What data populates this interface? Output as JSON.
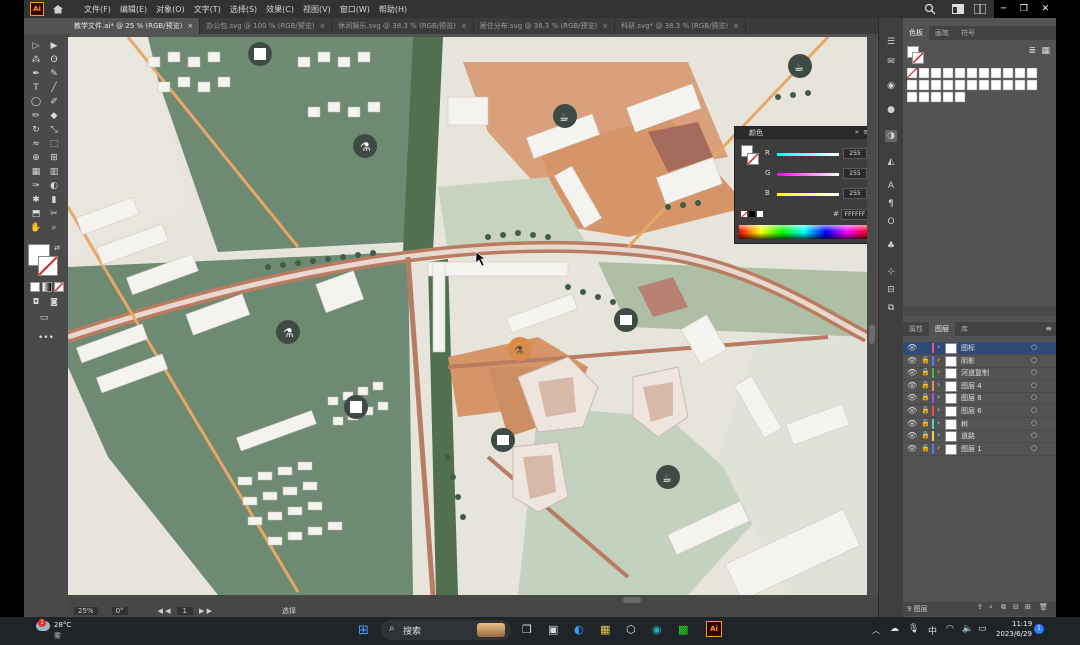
{
  "app": {
    "logo": "Ai"
  },
  "menu": [
    "文件(F)",
    "编辑(E)",
    "对象(O)",
    "文字(T)",
    "选择(S)",
    "效果(C)",
    "视图(V)",
    "窗口(W)",
    "帮助(H)"
  ],
  "tabs": [
    {
      "label": "教学文件.ai* @ 25 % (RGB/预览)",
      "active": true
    },
    {
      "label": "办公包.svg @ 100 % (RGB/预览)",
      "active": false
    },
    {
      "label": "休闲娱乐.svg @ 38.3 % (RGB/预览)",
      "active": false
    },
    {
      "label": "居住分布.svg @ 38.3 % (RGB/预览)",
      "active": false
    },
    {
      "label": "科研.svg* @ 38.3 % (RGB/预览)",
      "active": false
    }
  ],
  "swatch_panel": {
    "tabs": [
      "色板",
      "画笔",
      "符号"
    ]
  },
  "color_panel": {
    "title": "颜色",
    "r": "255",
    "g": "255",
    "b": "255",
    "hex": "FFFFFF",
    "labels": [
      "R",
      "G",
      "B"
    ]
  },
  "layers_panel": {
    "tabs": [
      "属性",
      "图层",
      "库"
    ],
    "layers": [
      {
        "name": "图标",
        "color": "#f04f7c",
        "selected": true
      },
      {
        "name": "阴影",
        "color": "#4f7cf0",
        "selected": false
      },
      {
        "name": "河道复制",
        "color": "#4fb04f",
        "selected": false
      },
      {
        "name": "图层 4",
        "color": "#f08c4f",
        "selected": false
      },
      {
        "name": "图层 8",
        "color": "#9c4ff0",
        "selected": false
      },
      {
        "name": "图层 6",
        "color": "#f04f4f",
        "selected": false
      },
      {
        "name": "树",
        "color": "#4fd0d0",
        "selected": false
      },
      {
        "name": "道路",
        "color": "#f0d04f",
        "selected": false
      },
      {
        "name": "图层 1",
        "color": "#4f7cf0",
        "selected": false
      }
    ],
    "count": "9 图层"
  },
  "status": {
    "zoom": "25%",
    "rotate": "0°",
    "page": "1",
    "tool": "选择"
  },
  "taskbar": {
    "weather_temp": "28°C",
    "weather_desc": "雾",
    "search": "搜索",
    "time": "11:19",
    "date": "2023/6/29",
    "ime": "中",
    "notif": "1"
  },
  "colors": {
    "accent": "#2f4a77",
    "canvas_bg": "#e8e6df",
    "green": "#6f8a72",
    "orange": "#d28a5a"
  }
}
